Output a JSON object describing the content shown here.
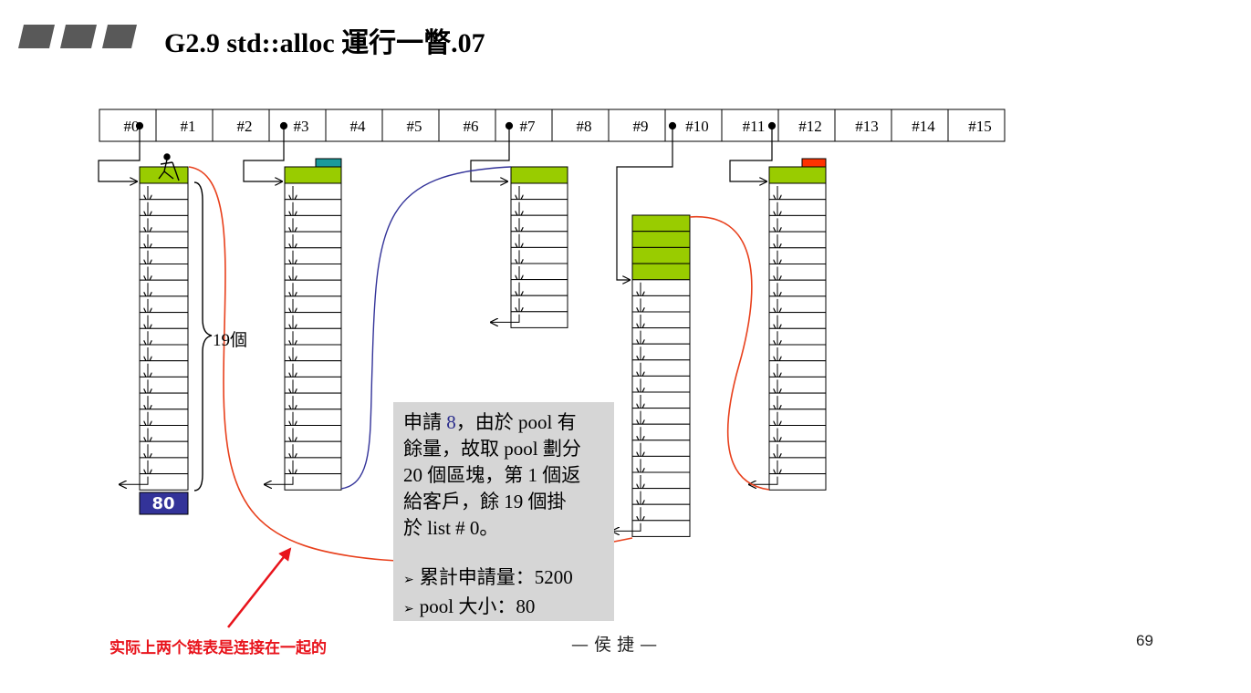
{
  "header": {
    "title": "G2.9 std::alloc 運行一瞥.07"
  },
  "free_list_header": {
    "cells": [
      "#0",
      "#1",
      "#2",
      "#3",
      "#4",
      "#5",
      "#6",
      "#7",
      "#8",
      "#9",
      "#10",
      "#11",
      "#12",
      "#13",
      "#14",
      "#15"
    ]
  },
  "diagram": {
    "count_label": "19個",
    "pool_badge": "80"
  },
  "note": {
    "line1_pre": "申請 ",
    "line1_num": "8",
    "line1_post": "，由於 pool 有",
    "line2": "餘量，故取 pool 劃分",
    "line3": "20 個區塊，第 1 個返",
    "line4": "給客戶，餘 19 個掛",
    "line5": "於 list # 0。",
    "stat1": "累計申請量：5200",
    "stat2": "pool 大小：80"
  },
  "footer": {
    "annotation": "实际上两个链表是连接在一起的",
    "author": "— 侯 捷 —",
    "page": "69"
  },
  "colors": {
    "green": "#99cc00",
    "teal": "#1a9a9a",
    "red_block": "#ff3300",
    "pool_blue": "#333399",
    "curve_red": "#e8401c",
    "curve_blue": "#333399",
    "arrow_red": "#e8141c"
  }
}
